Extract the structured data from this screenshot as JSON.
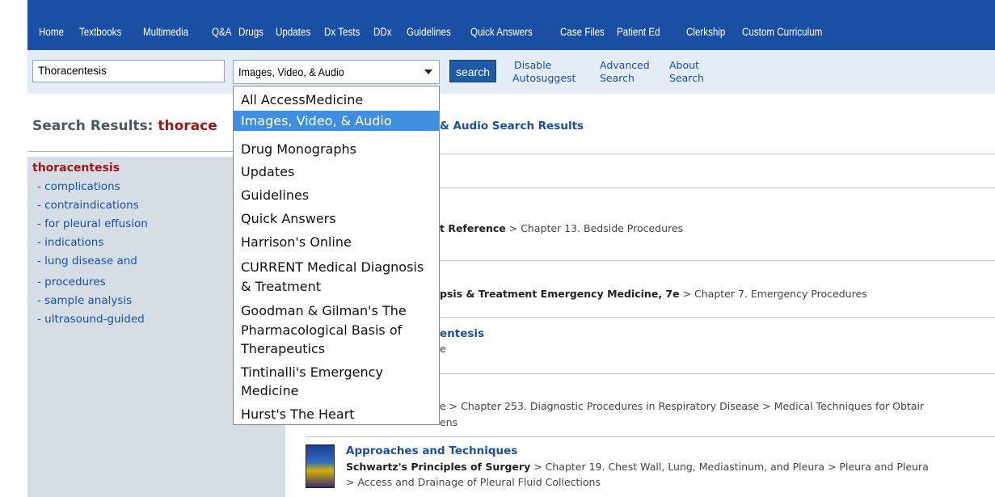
{
  "nav": [
    "Home",
    "Textbooks",
    "Multimedia",
    "Q&A",
    "Drugs",
    "Updates",
    "Dx Tests",
    "DDx",
    "Guidelines",
    "Quick Answers",
    "Case Files",
    "Patient Ed",
    "Clerkship",
    "Custom Curriculum"
  ],
  "search": {
    "query": "Thoracentesis",
    "scope_selected": "Images, Video, & Audio",
    "button": "search",
    "disable_line1": "Disable",
    "disable_line2": "Autosuggest",
    "advanced_line1": "Advanced",
    "advanced_line2": "Search",
    "about_line1": "About",
    "about_line2": "Search"
  },
  "dropdown": {
    "options": [
      "All AccessMedicine",
      "Images, Video, & Audio",
      "Drug Monographs",
      "Updates",
      "Guidelines",
      "Quick Answers",
      "Harrison's Online",
      "CURRENT Medical Diagnosis",
      "& Treatment",
      "Goodman & Gilman's The",
      "Pharmacological Basis of",
      "Therapeutics",
      "Tintinalli's Emergency",
      "Medicine",
      "Hurst's The Heart"
    ],
    "selected_index": 1,
    "highlight_color": "#3e8fe0"
  },
  "page": {
    "title_prefix": "Search Results: ",
    "title_query": "thorace",
    "results_heading": "& Audio Search Results"
  },
  "sidebar": {
    "title": "thoracentesis",
    "items": [
      "- complications",
      "- contraindications",
      "- for pleural effusion",
      "- indications",
      "- lung disease and",
      "- procedures",
      "- sample analysis",
      "- ultrasound-guided"
    ]
  },
  "results": [
    {
      "source": "t Reference",
      "path": " > Chapter 13. Bedside Procedures"
    },
    {
      "source": "psis & Treatment Emergency Medicine, 7e",
      "path": " > Chapter 7. Emergency Procedures"
    },
    {
      "title": "entesis",
      "frag": "e"
    },
    {
      "path": "e > Chapter 253. Diagnostic Procedures in Respiratory Disease > Medical Techniques for Obtair",
      "frag2": "ens"
    },
    {
      "title": "Approaches and Techniques",
      "source": "Schwartz's Principles of Surgery",
      "path": " > Chapter 19. Chest Wall, Lung, Mediastinum, and Pleura > Pleura and Pleura",
      "path2": "> Access and Drainage of Pleural Fluid Collections",
      "thumb_alt": "SURGERY"
    }
  ],
  "colors": {
    "nav_bg": "#1a4fa3",
    "searchbar_bg": "#e4ecf6",
    "link": "#1a4fa3",
    "query_red": "#a01818",
    "sidebar_bg": "#d5dde5"
  }
}
